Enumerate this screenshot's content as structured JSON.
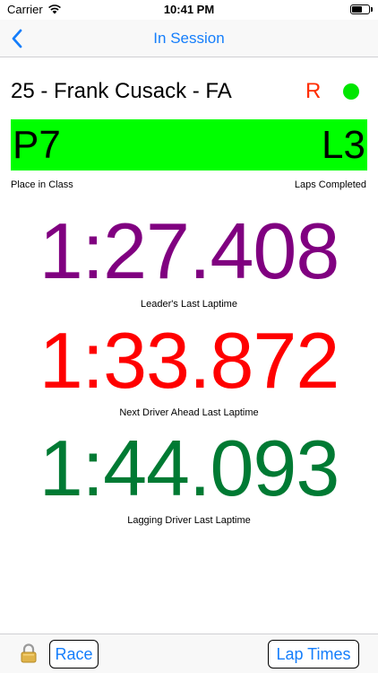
{
  "status_bar": {
    "carrier": "Carrier",
    "time": "10:41 PM",
    "battery_level": 0.65
  },
  "nav": {
    "title": "In Session",
    "back_icon": "chevron-left-icon"
  },
  "driver": {
    "name": "25 - Frank Cusack - FA",
    "flag": "R",
    "status_color": "#00e600"
  },
  "position": {
    "place": "P7",
    "laps": "L3",
    "place_label": "Place in Class",
    "laps_label": "Laps Completed",
    "bar_color": "#00ff00"
  },
  "laptimes": [
    {
      "time": "1:27.408",
      "label": "Leader's Last Laptime",
      "color": "#800080"
    },
    {
      "time": "1:33.872",
      "label": "Next Driver Ahead Last Laptime",
      "color": "#ff0000"
    },
    {
      "time": "1:44.093",
      "label": "Lagging Driver Last Laptime",
      "color": "#007a33"
    }
  ],
  "toolbar": {
    "lock_icon": "lock-icon",
    "race_label": "Race",
    "laptimes_label": "Lap Times"
  },
  "colors": {
    "accent": "#157efb",
    "flag": "#ff2d00"
  }
}
